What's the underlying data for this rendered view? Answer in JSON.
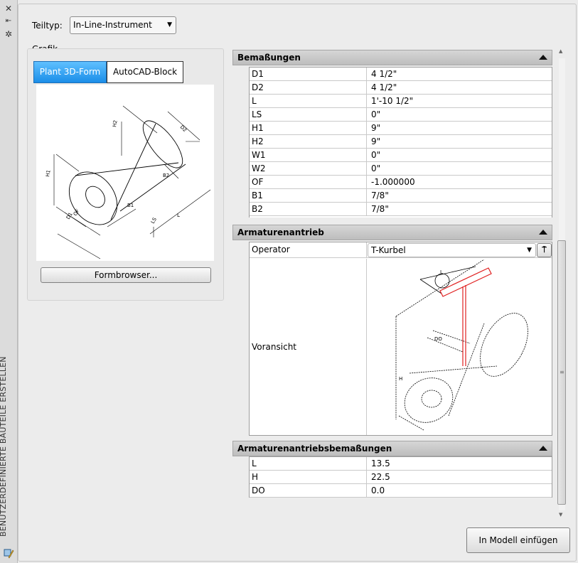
{
  "palette": {
    "title": "BENUTZERDEFINIERTE BAUTEILE ERSTELLEN",
    "close_glyph": "✕",
    "autohide_glyph": "⇤",
    "properties_glyph": "✲"
  },
  "part_type": {
    "label": "Teiltyp:",
    "value": "In-Line-Instrument"
  },
  "graphic": {
    "group_label": "Grafik",
    "tabs": [
      {
        "label": "Plant 3D-Form",
        "active": true
      },
      {
        "label": "AutoCAD-Block",
        "active": false
      }
    ],
    "preview_dims": [
      "H2",
      "D2",
      "B2",
      "H1",
      "D1",
      "OF",
      "B1",
      "LS",
      "L"
    ],
    "form_browser_label": "Formbrowser..."
  },
  "sections": {
    "dimensions": {
      "title": "Bemaßungen",
      "rows": [
        {
          "name": "D1",
          "value": "4 1/2\""
        },
        {
          "name": "D2",
          "value": "4 1/2\""
        },
        {
          "name": "L",
          "value": "1'-10 1/2\""
        },
        {
          "name": "LS",
          "value": "0\""
        },
        {
          "name": "H1",
          "value": "9\""
        },
        {
          "name": "H2",
          "value": "9\""
        },
        {
          "name": "W1",
          "value": "0\""
        },
        {
          "name": "W2",
          "value": "0\""
        },
        {
          "name": "OF",
          "value": "-1.000000"
        },
        {
          "name": "B1",
          "value": "7/8\""
        },
        {
          "name": "B2",
          "value": "7/8\""
        }
      ]
    },
    "actuator": {
      "title": "Armaturenantrieb",
      "operator_label": "Operator",
      "operator_value": "T-Kurbel",
      "preview_label": "Voransicht",
      "preview_dims": [
        "L",
        "H",
        "DO"
      ]
    },
    "actuator_dimensions": {
      "title": "Armaturenantriebsbemaßungen",
      "rows": [
        {
          "name": "L",
          "value": "13.5"
        },
        {
          "name": "H",
          "value": "22.5"
        },
        {
          "name": "DO",
          "value": "0.0"
        }
      ]
    }
  },
  "insert_button_label": "In Modell einfügen",
  "colors": {
    "tab_active": "#1b8ee8",
    "handle_red": "#e02020"
  }
}
